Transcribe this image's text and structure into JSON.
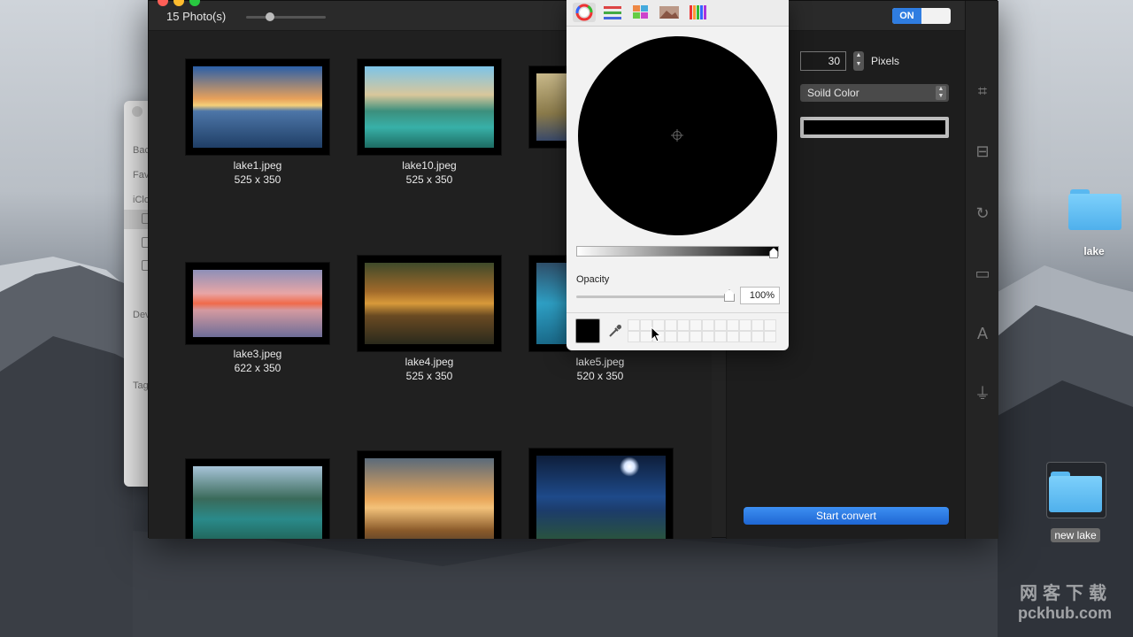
{
  "window": {
    "photo_count": "15 Photo(s)",
    "toggle_on_label": "ON"
  },
  "photos": [
    {
      "name": "lake1.jpeg",
      "dims": "525 x 350"
    },
    {
      "name": "lake10.jpeg",
      "dims": "525 x 350"
    },
    {
      "name": "lake3.jpeg",
      "dims": "622 x 350"
    },
    {
      "name": "lake4.jpeg",
      "dims": "525 x 350"
    },
    {
      "name": "lake5.jpeg",
      "dims": "520 x 350"
    }
  ],
  "settings": {
    "size_value": "30",
    "size_unit": "Pixels",
    "fill_type": "Soild Color",
    "fill_color": "#000000",
    "start_button": "Start convert"
  },
  "color_picker": {
    "opacity_label": "Opacity",
    "opacity_value": "100%",
    "selected_color": "#000000",
    "active_tab": "color-wheel"
  },
  "finder": {
    "back_label": "Back",
    "favorites_label": "Fav",
    "icloud_label": "iClo",
    "devices_label": "Dev",
    "tags_label": "Tag"
  },
  "desktop": {
    "folder1_label": "lake",
    "folder2_label": "new lake"
  },
  "watermark": {
    "cn": "网客下载",
    "en": "pckhub.com"
  },
  "colors": {
    "accent": "#2f7de1",
    "folder": "#6cc4f7"
  }
}
